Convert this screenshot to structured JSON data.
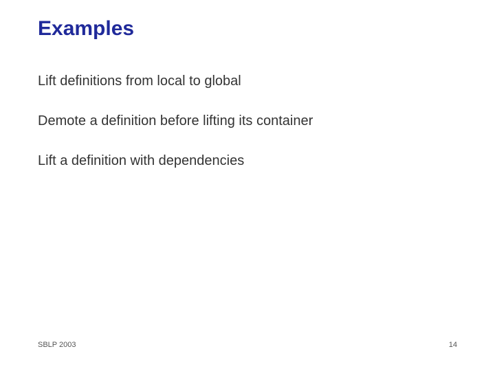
{
  "title": "Examples",
  "bullets": [
    "Lift definitions from local to global",
    "Demote a definition before lifting its container",
    "Lift a definition with dependencies"
  ],
  "footer": {
    "left": "SBLP 2003",
    "pageNumber": "14"
  }
}
